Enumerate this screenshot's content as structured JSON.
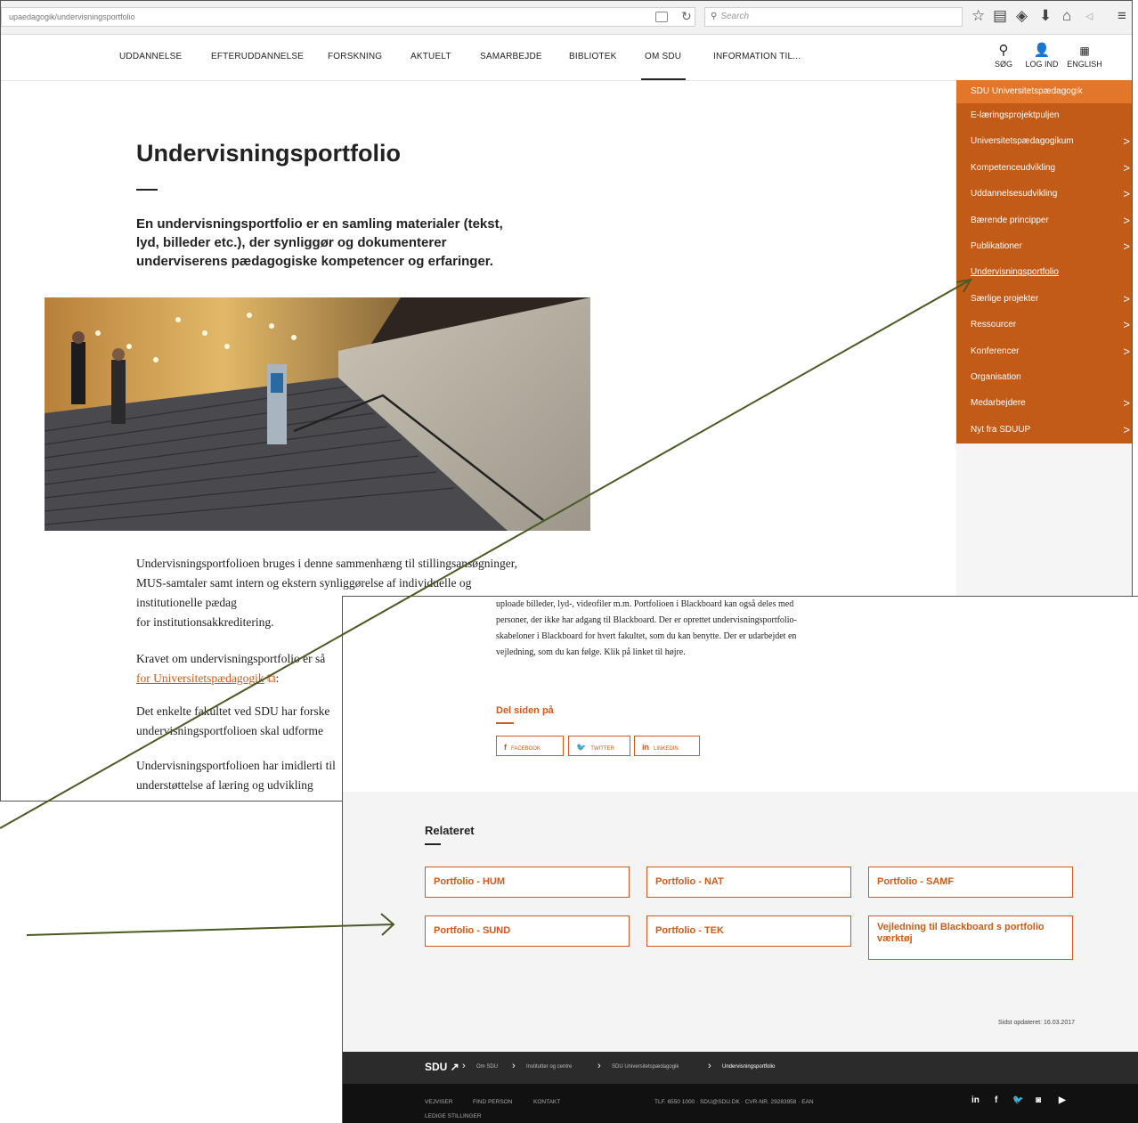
{
  "browser": {
    "url": "upaedagogik/undervisningsportfolio",
    "search_placeholder": "Search"
  },
  "nav": {
    "items": [
      "UDDANNELSE",
      "EFTERUDDANNELSE",
      "FORSKNING",
      "AKTUELT",
      "SAMARBEJDE",
      "BIBLIOTEK",
      "OM SDU",
      "INFORMATION TIL..."
    ],
    "search_label": "SØG",
    "login_label": "LOG IND",
    "english_label": "ENGLISH",
    "active": "OM SDU"
  },
  "sidemenu": {
    "heading": "SDU Universitetspædagogik",
    "items": [
      {
        "label": "E-læringsprojektpuljen",
        "chevron": ""
      },
      {
        "label": "Universitetspædagogikum",
        "chevron": ">"
      },
      {
        "label": "Kompetenceudvikling",
        "chevron": ">"
      },
      {
        "label": "Uddannelsesudvikling",
        "chevron": ">"
      },
      {
        "label": "Bærende principper",
        "chevron": ">"
      },
      {
        "label": "Publikationer",
        "chevron": ">"
      },
      {
        "label": "Undervisningsportfolio",
        "chevron": ""
      },
      {
        "label": "Særlige projekter",
        "chevron": ">"
      },
      {
        "label": "Ressourcer",
        "chevron": ">"
      },
      {
        "label": "Konferencer",
        "chevron": ">"
      },
      {
        "label": "Organisation",
        "chevron": ""
      },
      {
        "label": "Medarbejdere",
        "chevron": ">"
      },
      {
        "label": "Nyt fra SDUUP",
        "chevron": ">"
      }
    ]
  },
  "article": {
    "title": "Undervisningsportfolio",
    "lead": "En undervisningsportfolio er en samling materialer (tekst, lyd, billeder etc.), der synliggør og dokumenterer underviserens pædagogiske kompetencer og erfaringer.",
    "p1": "Undervisningsportfolioen bruges i denne sammenhæng til stillingsansøgninger, MUS-samtaler samt intern og ekstern synliggørelse af individuelle og institutionelle pædag",
    "p1_end": "for institutionsakkreditering.",
    "p2_start": "Kravet om undervisningsportfolio er så",
    "p2_link": "for Universitetspædagogik",
    "p2_end": ":",
    "p3": "Det enkelte fakultet ved SDU har forske undervisningsportfolioen skal udforme",
    "p4": "Undervisningsportfolioen har imidlerti til understøttelse af læring og udvikling"
  },
  "lower": {
    "body": "uploade billeder, lyd-, videofiler m.m. Portfolioen i Blackboard kan også deles med personer, der ikke har adgang til Blackboard. Der er oprettet undervisningsportfolio-skabeloner i Blackboard for hvert fakultet, som du kan benytte. Der er udarbejdet en vejledning, som du kan følge. Klik på linket til højre.",
    "share_title": "Del siden på",
    "share": [
      {
        "icon": "f",
        "label": "FACEBOOK"
      },
      {
        "icon": "🐦",
        "label": "TWITTER"
      },
      {
        "icon": "in",
        "label": "LINKEDIN"
      }
    ],
    "related_title": "Relateret",
    "related": [
      "Portfolio - HUM",
      "Portfolio - NAT",
      "Portfolio - SAMF",
      "Portfolio - SUND",
      "Portfolio - TEK",
      "Vejledning til Blackboard s portfolio værktøj"
    ],
    "updated": "Sidst opdateret: 16.03.2017",
    "logo": "SDU",
    "breadcrumb": [
      "Om SDU",
      "Institutter og centre",
      "SDU Universitetspædagogik",
      "Undervisningsportfolio"
    ],
    "footer": [
      "VEJVISER",
      "FIND PERSON",
      "KONTAKT",
      "LEDIGE STILLINGER"
    ],
    "footer_contact": "TLF. 6550 1000 · SDU@SDU.DK · CVR-NR. 29283958 · EAN",
    "social": [
      "in",
      "f",
      "🐦",
      "◙",
      "▶"
    ]
  },
  "colors": {
    "accent": "#d05a17",
    "menu_bg": "#c25a18",
    "menu_head": "#e2762b",
    "arrow": "#4a5a22"
  }
}
